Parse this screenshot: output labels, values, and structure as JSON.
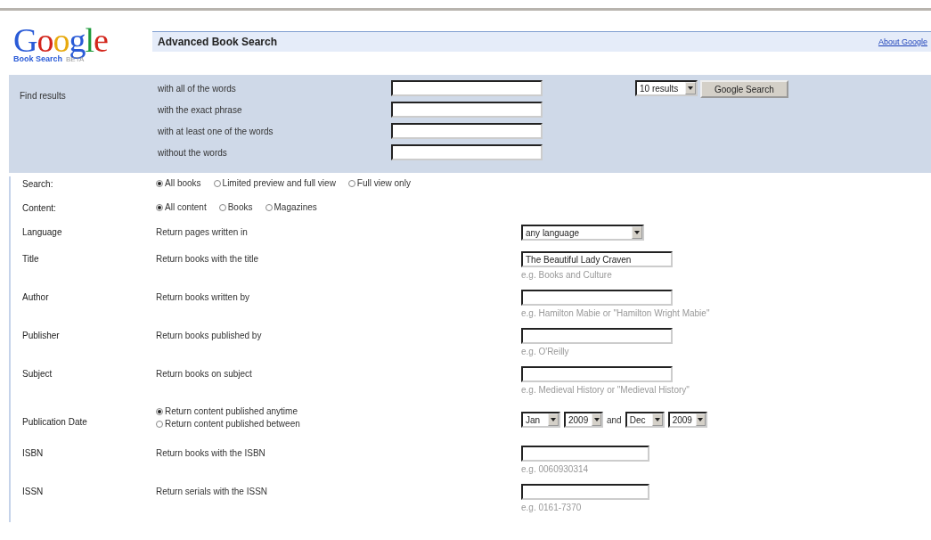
{
  "header": {
    "logo": {
      "word": "Google",
      "sub": "Book Search",
      "badge": "BETA"
    },
    "title": "Advanced Book Search",
    "link": "About Google"
  },
  "find": {
    "label": "Find results",
    "rows": [
      {
        "label": "with all of the words"
      },
      {
        "label": "with the exact phrase"
      },
      {
        "label": "with at least one of the words"
      },
      {
        "label": "without the words"
      }
    ],
    "results_select": "10 results",
    "button": "Google Search"
  },
  "options": [
    {
      "kind": "radio",
      "label": "Search:",
      "options": [
        {
          "label": "All books",
          "selected": true
        },
        {
          "label": "Limited preview and full view",
          "selected": false
        },
        {
          "label": "Full view only",
          "selected": false
        }
      ]
    },
    {
      "kind": "radio",
      "label": "Content:",
      "options": [
        {
          "label": "All content",
          "selected": true
        },
        {
          "label": "Books",
          "selected": false
        },
        {
          "label": "Magazines",
          "selected": false
        }
      ]
    },
    {
      "kind": "select",
      "label": "Language",
      "description": "Return pages written in",
      "value": "any language"
    },
    {
      "kind": "text",
      "label": "Title",
      "description": "Return books with the title",
      "value": "The Beautiful Lady Craven",
      "hint": "e.g. Books and Culture"
    },
    {
      "kind": "text",
      "label": "Author",
      "description": "Return books written by",
      "hint": "e.g. Hamilton Mabie or \"Hamilton Wright Mabie\""
    },
    {
      "kind": "text",
      "label": "Publisher",
      "description": "Return books published by",
      "hint": "e.g. O'Reilly"
    },
    {
      "kind": "text",
      "label": "Subject",
      "description": "Return books on subject",
      "hint": "e.g. Medieval History or \"Medieval History\""
    },
    {
      "kind": "date",
      "label": "Publication Date",
      "options": [
        {
          "label": "Return content published anytime",
          "selected": true
        },
        {
          "label": "Return content published between",
          "selected": false
        }
      ],
      "from_month": "Jan",
      "from_year": "2009",
      "joiner": "and",
      "to_month": "Dec",
      "to_year": "2009"
    },
    {
      "kind": "short_text",
      "label": "ISBN",
      "description": "Return books with the ISBN",
      "hint": "e.g. 0060930314"
    },
    {
      "kind": "short_text",
      "label": "ISSN",
      "description": "Return serials with the ISSN",
      "hint": "e.g. 0161-7370"
    }
  ]
}
